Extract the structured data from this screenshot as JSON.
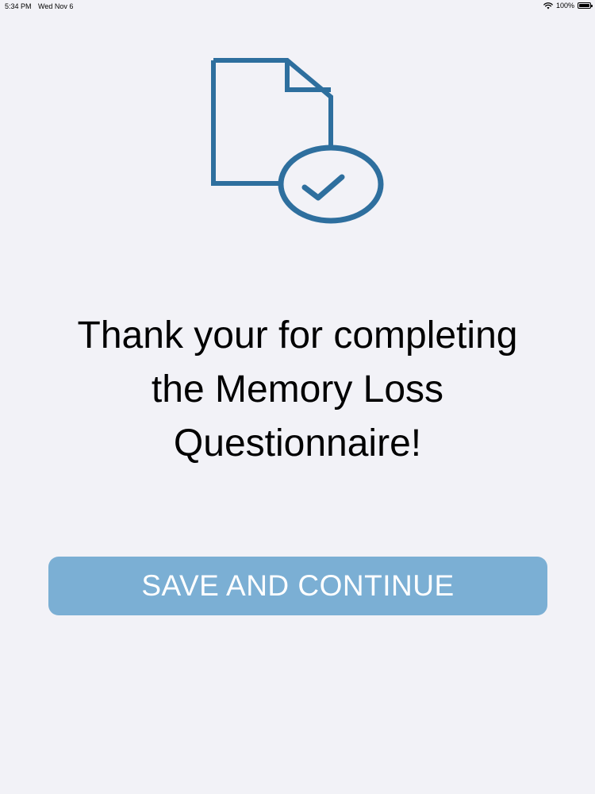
{
  "status_bar": {
    "time": "5:34 PM",
    "date": "Wed Nov 6",
    "battery": "100%",
    "wifi_icon": "wifi-icon",
    "battery_icon": "battery-icon"
  },
  "hero": {
    "icon": "document-check-icon",
    "color": "#2e6f9e"
  },
  "message": {
    "text": "Thank your for completing\nthe Memory Loss\nQuestionnaire!"
  },
  "actions": {
    "save_label": "SAVE AND CONTINUE",
    "button_color": "#7bafd4"
  }
}
